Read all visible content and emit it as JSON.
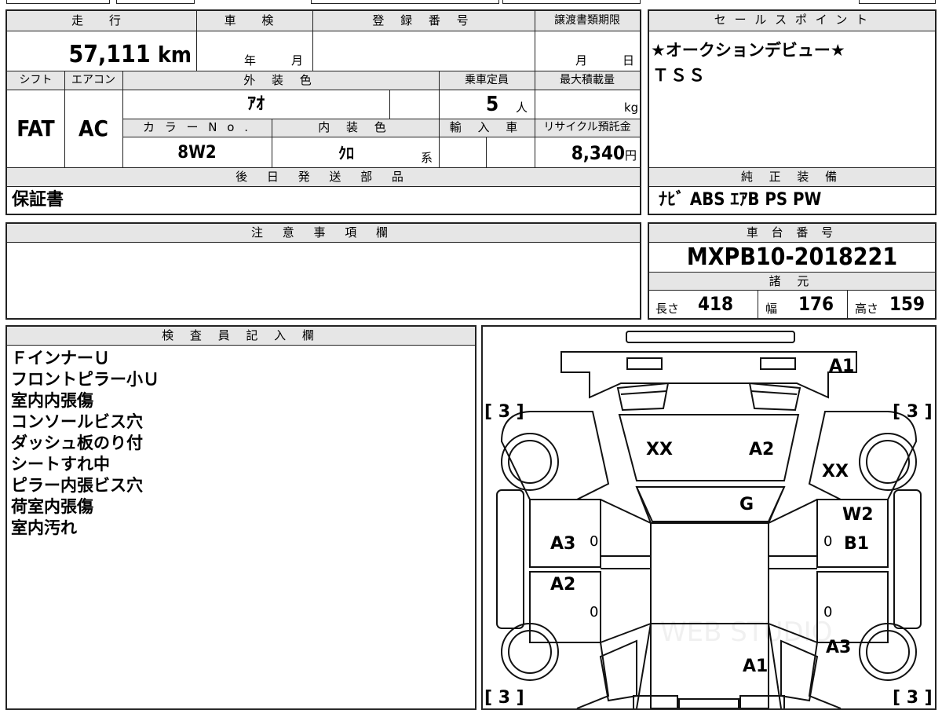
{
  "main_table": {
    "mileage_header": "走 行",
    "mileage_value": "57,111",
    "mileage_unit": "km",
    "shaken_header": "車 検",
    "shaken_year_unit": "年",
    "shaken_month_unit": "月",
    "reg_header": "登 録 番 号",
    "transfer_header": "譲渡書類期限",
    "transfer_month_unit": "月",
    "transfer_day_unit": "日",
    "shift_header": "シフト",
    "shift_value": "FAT",
    "ac_header": "エアコン",
    "ac_value": "AC",
    "exterior_header": "外 装 色",
    "exterior_value": "ｱｵ",
    "capacity_header": "乗車定員",
    "capacity_value": "5",
    "capacity_unit": "人",
    "load_header": "最大積載量",
    "load_unit": "kg",
    "color_no_header": "カ ラ ー N o .",
    "color_no_value": "8W2",
    "interior_header": "内 装 色",
    "interior_value": "ｸﾛ",
    "interior_suffix": "系",
    "import_header": "輸 入 車",
    "recycle_header": "リサイクル預託金",
    "recycle_value": "8,340",
    "recycle_unit": "円",
    "later_parts_header": "後 日 発 送 部 品",
    "later_parts_value": "保証書"
  },
  "sales_point": {
    "header": "セ ー ル ス ポ イ ン ト",
    "lines": [
      "★オークションデビュー★",
      "ＴＳＳ"
    ]
  },
  "equipment": {
    "header": "純 正 装 備",
    "value": "ﾅﾋﾞ ABS ｴｱB PS PW"
  },
  "caution": {
    "header": "注 意 事 項 欄"
  },
  "chassis": {
    "header": "車 台 番 号",
    "value": "MXPB10-2018221",
    "spec_header": "諸 元",
    "length_label": "長さ",
    "length_value": "418",
    "width_label": "幅",
    "width_value": "176",
    "height_label": "高さ",
    "height_value": "159"
  },
  "inspector": {
    "header": "検 査 員 記 入 欄",
    "notes": [
      "ＦインナーＵ",
      "フロントピラー小Ｕ",
      "室内内張傷",
      "コンソールビス穴",
      "ダッシュ板のり付",
      "シートすれ中",
      "ピラー内張ビス穴",
      "荷室内張傷",
      "室内汚れ"
    ]
  },
  "diagram": {
    "marks": {
      "front_right": "A1",
      "hood_left": "XX",
      "hood_right": "A2",
      "fender_right": "XX",
      "windshield": "G",
      "door_fr_top": "W2",
      "door_fr": "B1",
      "door_fl": "A3",
      "door_rl": "A2",
      "rear_right": "A3",
      "rear_center": "A1"
    },
    "tire_labels": [
      "[ 3 ]",
      "[ 3 ]",
      "[ 3 ]",
      "[ 3 ]"
    ],
    "zero": "0",
    "watermark": "WEB STUDIO"
  }
}
